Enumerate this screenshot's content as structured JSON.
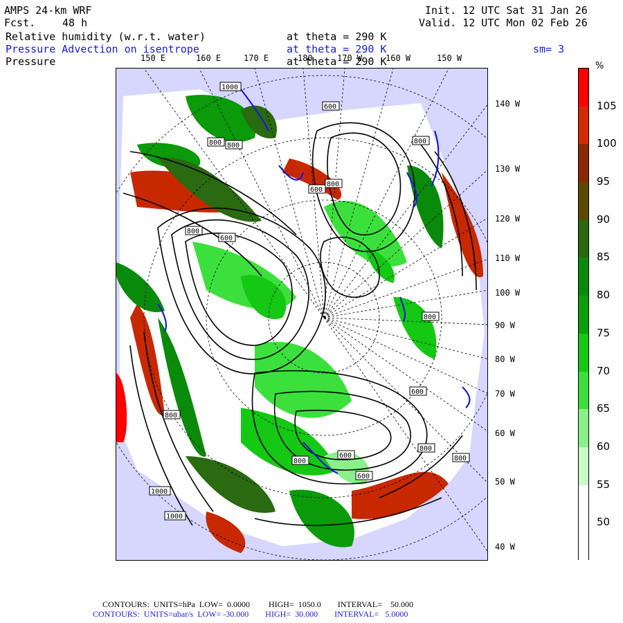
{
  "header": {
    "model": "AMPS 24-km WRF",
    "fcst_label": "Fcst.",
    "fcst_value": "48 h",
    "init": "Init. 12 UTC Sat 31 Jan 26",
    "valid": "Valid. 12 UTC Mon 02 Feb 26",
    "fields": [
      {
        "name": "Relative humidity (w.r.t. water)",
        "level": "at theta = 290 K",
        "color": "#000000"
      },
      {
        "name": "Pressure Advection on isentrope",
        "level": "at theta = 290 K",
        "color": "#1a1ad6",
        "smooth": "sm= 3"
      },
      {
        "name": "Pressure",
        "level": "at theta = 290 K",
        "color": "#000000"
      }
    ]
  },
  "map": {
    "longitudes_top": [
      "150 E",
      "160 E",
      "170 E",
      "180",
      "170 W",
      "160 W",
      "150 W"
    ],
    "longitudes_right": [
      "140 W",
      "130 W",
      "120 W",
      "110 W",
      "100 W",
      "90 W",
      "80 W",
      "70 W",
      "60 W",
      "50 W",
      "40 W"
    ],
    "contour_labels": [
      "1000",
      "800",
      "800",
      "600",
      "600",
      "800",
      "800",
      "600",
      "800",
      "800",
      "600",
      "600",
      "800",
      "800",
      "1000",
      "1000",
      "800",
      "800",
      "600"
    ],
    "colors": {
      "ocean": "#d6d6ff",
      "rh_105": "#ff0000",
      "rh_100": "#d42a00",
      "rh_95": "#8b2a00",
      "rh_90": "#5a4a00",
      "rh_85": "#2a6a10",
      "rh_80": "#0a8a0a",
      "rh_75": "#0aa00a",
      "rh_70": "#14c814",
      "rh_65": "#3ce03c",
      "rh_60": "#8af08a",
      "rh_55": "#c8fac8",
      "rh_50": "#ffffff",
      "contour": "#000000",
      "advection": "#1a1ad6"
    }
  },
  "colorbar": {
    "unit": "%",
    "labels": [
      "105",
      "100",
      "95",
      "90",
      "85",
      "80",
      "75",
      "70",
      "65",
      "60",
      "55",
      "50"
    ],
    "colors": [
      "#ff0000",
      "#d42a00",
      "#8b2a00",
      "#5a4a00",
      "#2a6a10",
      "#0a8a0a",
      "#0aa00a",
      "#14c814",
      "#3ce03c",
      "#8af08a",
      "#c8fac8",
      "#ffffff",
      "#ffffff"
    ]
  },
  "footer": {
    "line1": "CONTOURS:  UNITS=hPa  LOW=  0.0000         HIGH=  1050.0        INTERVAL=    50.000",
    "line2": "CONTOURS:  UNITS=ubar/s  LOW= -30.000        HIGH=  30.000        INTERVAL=   5.0000"
  }
}
